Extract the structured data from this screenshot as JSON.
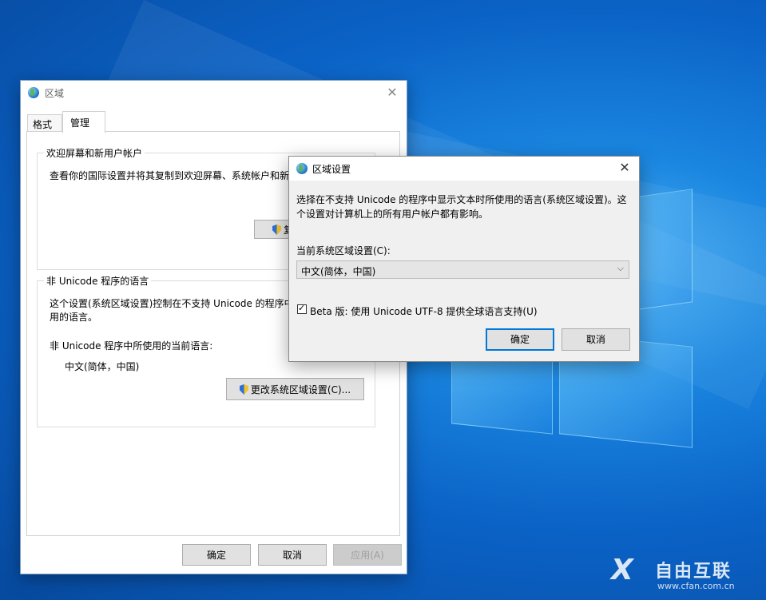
{
  "region_window": {
    "title": "区域",
    "tabs": [
      {
        "label": "格式",
        "active": false
      },
      {
        "label": "管理",
        "active": true
      }
    ],
    "welcome_group": {
      "title": "欢迎屏幕和新用户帐户",
      "description": "查看你的国际设置并将其复制到欢迎屏幕、系统帐户和新",
      "copy_button_label": "复"
    },
    "nonunicode_group": {
      "title": "非 Unicode 程序的语言",
      "description_line1": "这个设置(系统区域设置)控制在不支持 Unicode 的程序中",
      "description_line2": "用的语言。",
      "current_label": "非 Unicode 程序中所使用的当前语言:",
      "current_value": "中文(简体，中国)",
      "change_button_label": "更改系统区域设置(C)..."
    },
    "footer": {
      "ok_label": "确定",
      "cancel_label": "取消",
      "apply_label": "应用(A)"
    }
  },
  "region_settings_dialog": {
    "title": "区域设置",
    "description_line1": "选择在不支持 Unicode 的程序中显示文本时所使用的语言(系统区域设置)。这",
    "description_line2": "个设置对计算机上的所有用户帐户都有影响。",
    "current_label": "当前系统区域设置(C):",
    "selected_locale": "中文(简体，中国)",
    "beta_checkbox_label": "Beta 版: 使用 Unicode UTF-8 提供全球语言支持(U)",
    "beta_checked": true,
    "ok_label": "确定",
    "cancel_label": "取消"
  },
  "watermark": {
    "brand": "自由互联",
    "url": "www.cfan.com.cn"
  },
  "colors": {
    "desktop_blue": "#0b63c7",
    "focus_blue": "#0078d7",
    "button_gray": "#e1e1e1"
  }
}
